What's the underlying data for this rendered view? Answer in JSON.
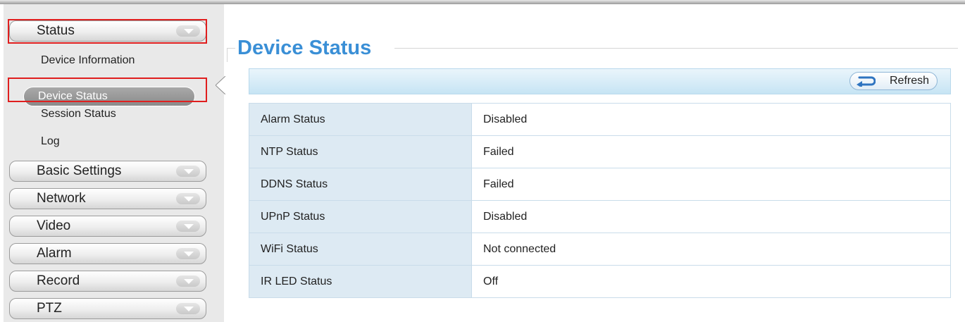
{
  "sidebar": {
    "status_label": "Status",
    "status_items": [
      "Device Information",
      "Device Status",
      "Session Status",
      "Log"
    ],
    "categories": [
      "Basic Settings",
      "Network",
      "Video",
      "Alarm",
      "Record",
      "PTZ"
    ]
  },
  "page": {
    "title": "Device Status",
    "refresh_label": "Refresh"
  },
  "status_table": [
    {
      "label": "Alarm Status",
      "value": "Disabled"
    },
    {
      "label": "NTP Status",
      "value": "Failed"
    },
    {
      "label": "DDNS Status",
      "value": "Failed"
    },
    {
      "label": "UPnP Status",
      "value": "Disabled"
    },
    {
      "label": "WiFi Status",
      "value": "Not connected"
    },
    {
      "label": "IR LED Status",
      "value": "Off"
    }
  ],
  "colors": {
    "title": "#3a8fd6",
    "highlight": "#e01e1e",
    "toolbar": "#c6e4f4"
  }
}
